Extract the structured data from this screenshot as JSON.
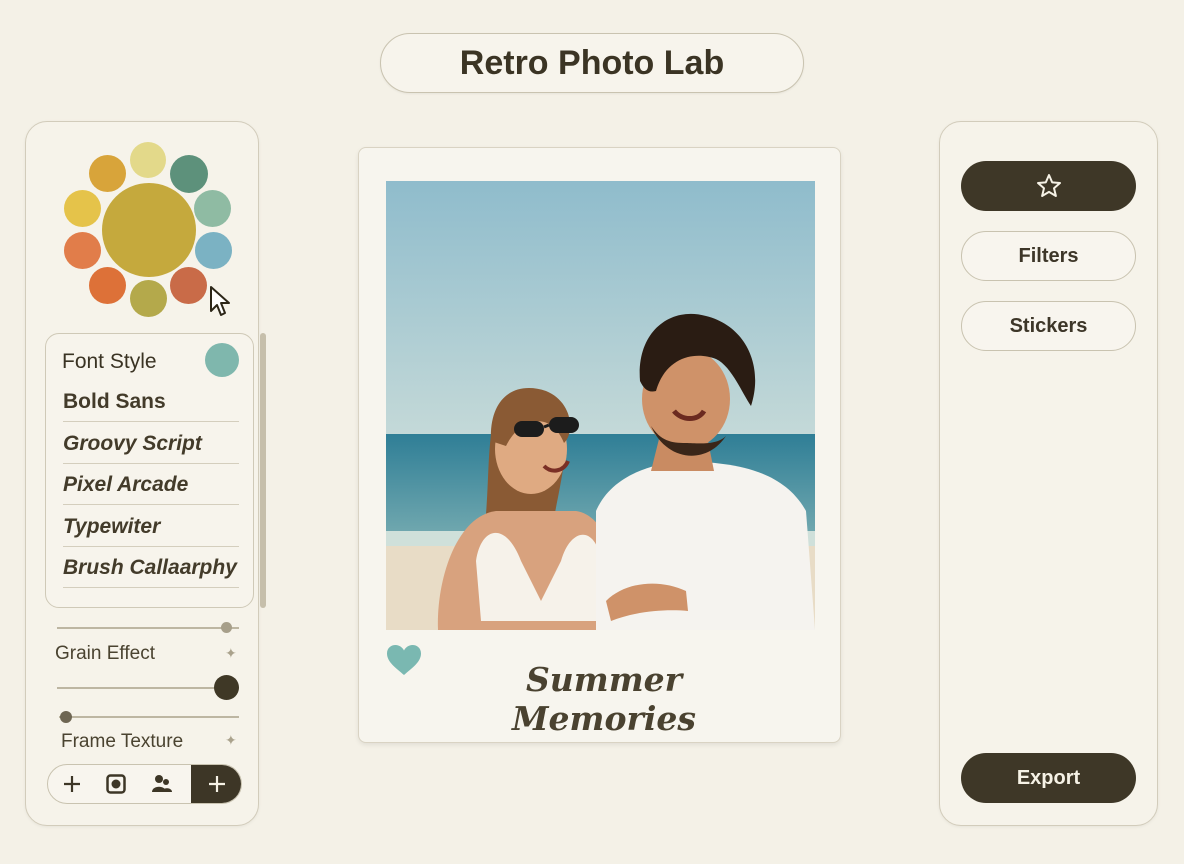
{
  "app": {
    "title": "Retro Photo Lab"
  },
  "palette": {
    "center": "#c5a93d",
    "swatches": [
      "#e3d98a",
      "#5d917b",
      "#8fbba3",
      "#7bb2c3",
      "#c96b48",
      "#b4a94b",
      "#dd7138",
      "#e17d4a",
      "#e5c34a",
      "#d8a43a"
    ],
    "cursor_icon": "pointer-cursor-icon"
  },
  "fonts": {
    "header": "Font Style",
    "header_swatch": "#7fb7ad",
    "items": [
      {
        "label": "Bold Sans",
        "italic": false
      },
      {
        "label": "Groovy Script",
        "italic": true
      },
      {
        "label": "Pixel Arcade",
        "italic": true
      },
      {
        "label": "Typewiter",
        "italic": true
      },
      {
        "label": "Brush Callaarphy",
        "italic": true
      }
    ]
  },
  "adjustments": {
    "grain_label": "Grain Effect",
    "frame_label": "Frame Texture",
    "top_slider": 0.93,
    "grain_slider": 0.93,
    "frame_slider": 0.04
  },
  "toolbar": {
    "icons": [
      "plus-icon",
      "frame-icon",
      "people-icon"
    ],
    "primary_icon": "plus-icon"
  },
  "polaroid": {
    "caption": "Summer Memories",
    "heart_color": "#7ab8b1"
  },
  "side_actions": {
    "favorite_icon": "star-icon",
    "filters_label": "Filters",
    "stickers_label": "Stickers",
    "export_label": "Export"
  }
}
